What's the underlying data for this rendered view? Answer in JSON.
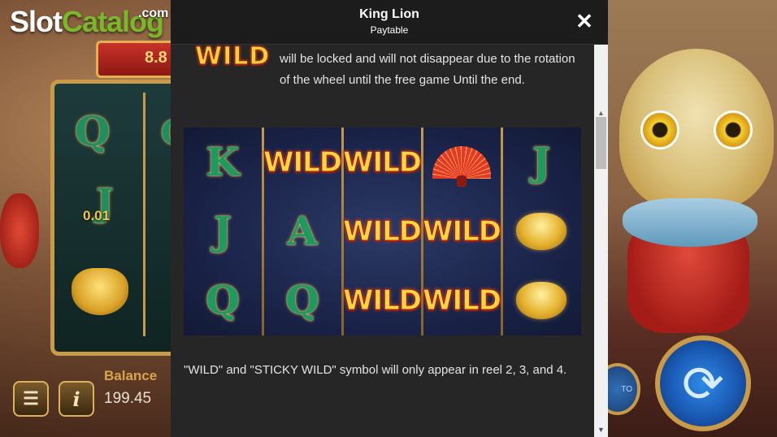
{
  "site": {
    "logo_main": "Slot",
    "logo_accent": "Catalog",
    "logo_suffix": ".com"
  },
  "game": {
    "banner_value": "8.8",
    "prize_value": "0.01",
    "reel_symbols": [
      "Q",
      "Q",
      "J"
    ],
    "balance_label": "Balance",
    "balance_value": "199.45",
    "menu_icon": "hamburger-menu-icon",
    "info_icon": "info-icon",
    "auto_label": "TO",
    "spin_icon": "refresh-spin-icon"
  },
  "paytable": {
    "title": "King Lion",
    "subtitle": "Paytable",
    "close_glyph": "✕",
    "wild_symbol_label": "WILD",
    "paragraph_1": "will be locked and will not disappear due to the rotation of the wheel until the free game Until the end.",
    "example_grid": {
      "rows": [
        [
          "K",
          "WILD",
          "WILD",
          "fan",
          "J"
        ],
        [
          "J",
          "A",
          "WILD",
          "WILD",
          "gold-ingot"
        ],
        [
          "Q",
          "Q",
          "WILD",
          "WILD",
          "gold-ingot"
        ]
      ]
    },
    "paragraph_2": "\"WILD\" and \"STICKY WILD\" symbol will only appear in reel 2, 3, and 4."
  },
  "colors": {
    "modal_bg": "#262626",
    "header_bg": "#1c1c1c",
    "text": "#e4e4e4",
    "gold": "#c99a47",
    "wild_yellow": "#ffd640",
    "symbol_green": "#1f9a5f"
  }
}
